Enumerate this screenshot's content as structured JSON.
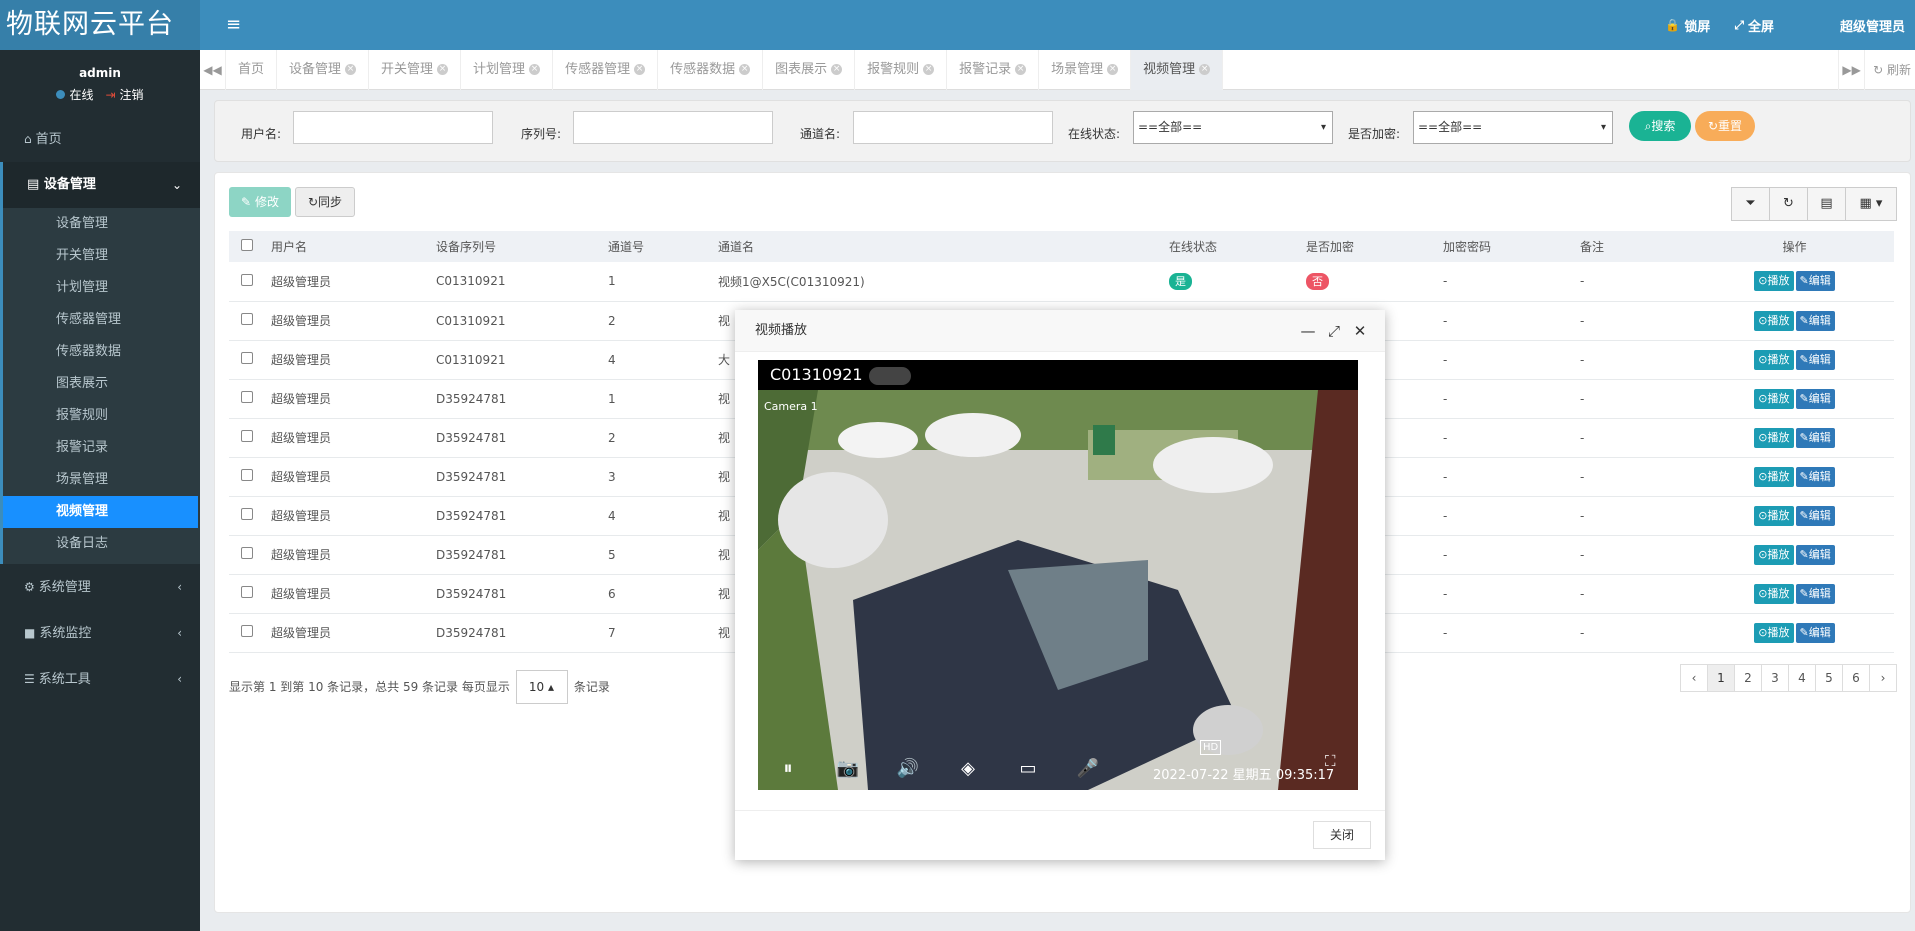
{
  "app": {
    "brand": "物联网云平台"
  },
  "topbar": {
    "lock": "锁屏",
    "fullscreen": "全屏",
    "user": "超级管理员"
  },
  "user_panel": {
    "name": "admin",
    "status": "在线",
    "logout": "注销"
  },
  "sidebar": {
    "home": "首页",
    "device_group": "设备管理",
    "sub_items": [
      "设备管理",
      "开关管理",
      "计划管理",
      "传感器管理",
      "传感器数据",
      "图表展示",
      "报警规则",
      "报警记录",
      "场景管理",
      "视频管理",
      "设备日志"
    ],
    "system_mgmt": "系统管理",
    "system_monitor": "系统监控",
    "system_tools": "系统工具"
  },
  "tabs": [
    "首页",
    "设备管理",
    "开关管理",
    "计划管理",
    "传感器管理",
    "传感器数据",
    "图表展示",
    "报警规则",
    "报警记录",
    "场景管理",
    "视频管理"
  ],
  "tabs_refresh": "刷新",
  "filter": {
    "username_label": "用户名:",
    "serial_label": "序列号:",
    "channel_label": "通道名:",
    "online_label": "在线状态:",
    "online_value": "==全部==",
    "encrypt_label": "是否加密:",
    "encrypt_value": "==全部==",
    "search": "搜索",
    "reset": "重置"
  },
  "toolbar": {
    "edit": "修改",
    "sync": "同步"
  },
  "table": {
    "headers": [
      "用户名",
      "设备序列号",
      "通道号",
      "通道名",
      "在线状态",
      "是否加密",
      "加密密码",
      "备注",
      "操作"
    ],
    "rows": [
      [
        "超级管理员",
        "C01310921",
        "1",
        "视频1@X5C(C01310921)",
        "是",
        "否",
        "-",
        "-"
      ],
      [
        "超级管理员",
        "C01310921",
        "2",
        "视",
        "",
        "",
        "-",
        "-"
      ],
      [
        "超级管理员",
        "C01310921",
        "4",
        "大",
        "",
        "",
        "-",
        "-"
      ],
      [
        "超级管理员",
        "D35924781",
        "1",
        "视",
        "",
        "",
        "-",
        "-"
      ],
      [
        "超级管理员",
        "D35924781",
        "2",
        "视",
        "",
        "",
        "-",
        "-"
      ],
      [
        "超级管理员",
        "D35924781",
        "3",
        "视",
        "",
        "",
        "-",
        "-"
      ],
      [
        "超级管理员",
        "D35924781",
        "4",
        "视",
        "",
        "",
        "-",
        "-"
      ],
      [
        "超级管理员",
        "D35924781",
        "5",
        "视",
        "",
        "",
        "-",
        "-"
      ],
      [
        "超级管理员",
        "D35924781",
        "6",
        "视",
        "",
        "",
        "-",
        "-"
      ],
      [
        "超级管理员",
        "D35924781",
        "7",
        "视",
        "",
        "",
        "-",
        "-"
      ]
    ],
    "play": "播放",
    "edit": "编辑"
  },
  "pagination": {
    "info": "显示第 1 到第 10 条记录，总共 59 条记录",
    "per_page_prefix": "每页显示",
    "per_page": "10",
    "per_page_suffix": "条记录",
    "pages": [
      "‹",
      "1",
      "2",
      "3",
      "4",
      "5",
      "6",
      "›"
    ]
  },
  "modal": {
    "title": "视频播放",
    "player_title": "C01310921",
    "camera_label": "Camera 1",
    "hd": "HD",
    "timestamp": "2022-07-22 星期五 09:35:17",
    "close": "关闭"
  }
}
